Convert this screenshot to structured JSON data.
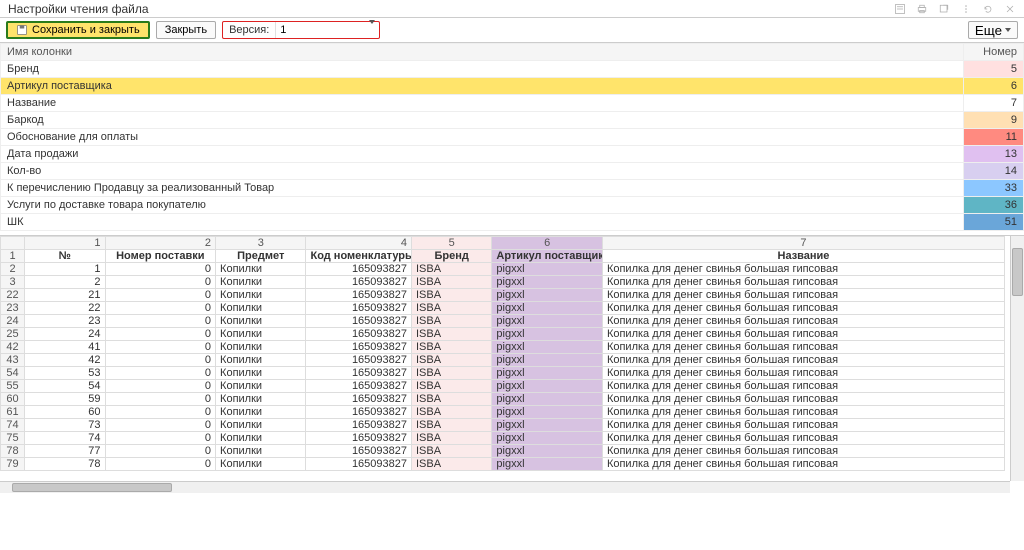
{
  "title": "Настройки чтения файла",
  "toolbar": {
    "save_close": "Сохранить и закрыть",
    "close": "Закрыть",
    "version_label": "Версия:",
    "version_value": "1",
    "more": "Еще"
  },
  "columns_table": {
    "col_name_header": "Имя колонки",
    "number_header": "Номер",
    "rows": [
      {
        "name": "Бренд",
        "num": 5,
        "color": "bg-pink"
      },
      {
        "name": "Артикул поставщика",
        "num": 6,
        "color": "bg-purple",
        "selected": true
      },
      {
        "name": "Название",
        "num": 7,
        "color": ""
      },
      {
        "name": "Баркод",
        "num": 9,
        "color": "bg-peach"
      },
      {
        "name": "Обоснование для оплаты",
        "num": 11,
        "color": "bg-salmon"
      },
      {
        "name": "Дата продажи",
        "num": 13,
        "color": "bg-violet"
      },
      {
        "name": "Кол-во",
        "num": 14,
        "color": "bg-lilac"
      },
      {
        "name": "К перечислению Продавцу за реализованный Товар",
        "num": 33,
        "color": "bg-sky"
      },
      {
        "name": "Услуги по доставке товара покупателю",
        "num": 36,
        "color": "bg-teal"
      },
      {
        "name": "ШК",
        "num": 51,
        "color": "bg-blue2"
      }
    ]
  },
  "sheet": {
    "col_numbers": [
      "",
      "1",
      "2",
      "3",
      "4",
      "5",
      "6",
      "7"
    ],
    "headers": {
      "c2": "№",
      "c3": "Номер поставки",
      "c4": "Предмет",
      "c5": "Код номенклатуры",
      "c6": "Бренд",
      "c7": "Артикул поставщика",
      "c8": "Название"
    },
    "rows": [
      {
        "rh": "2",
        "n": 1,
        "post": 0,
        "subj": "Копилки",
        "code": 165093827,
        "brand": "ISBA",
        "art": "pigxxl",
        "name": "Копилка для денег свинья большая гипсовая"
      },
      {
        "rh": "3",
        "n": 2,
        "post": 0,
        "subj": "Копилки",
        "code": 165093827,
        "brand": "ISBA",
        "art": "pigxxl",
        "name": "Копилка для денег свинья большая гипсовая"
      },
      {
        "rh": "22",
        "n": 21,
        "post": 0,
        "subj": "Копилки",
        "code": 165093827,
        "brand": "ISBA",
        "art": "pigxxl",
        "name": "Копилка для денег свинья большая гипсовая"
      },
      {
        "rh": "23",
        "n": 22,
        "post": 0,
        "subj": "Копилки",
        "code": 165093827,
        "brand": "ISBA",
        "art": "pigxxl",
        "name": "Копилка для денег свинья большая гипсовая"
      },
      {
        "rh": "24",
        "n": 23,
        "post": 0,
        "subj": "Копилки",
        "code": 165093827,
        "brand": "ISBA",
        "art": "pigxxl",
        "name": "Копилка для денег свинья большая гипсовая"
      },
      {
        "rh": "25",
        "n": 24,
        "post": 0,
        "subj": "Копилки",
        "code": 165093827,
        "brand": "ISBA",
        "art": "pigxxl",
        "name": "Копилка для денег свинья большая гипсовая"
      },
      {
        "rh": "42",
        "n": 41,
        "post": 0,
        "subj": "Копилки",
        "code": 165093827,
        "brand": "ISBA",
        "art": "pigxxl",
        "name": "Копилка для денег свинья большая гипсовая"
      },
      {
        "rh": "43",
        "n": 42,
        "post": 0,
        "subj": "Копилки",
        "code": 165093827,
        "brand": "ISBA",
        "art": "pigxxl",
        "name": "Копилка для денег свинья большая гипсовая"
      },
      {
        "rh": "54",
        "n": 53,
        "post": 0,
        "subj": "Копилки",
        "code": 165093827,
        "brand": "ISBA",
        "art": "pigxxl",
        "name": "Копилка для денег свинья большая гипсовая"
      },
      {
        "rh": "55",
        "n": 54,
        "post": 0,
        "subj": "Копилки",
        "code": 165093827,
        "brand": "ISBA",
        "art": "pigxxl",
        "name": "Копилка для денег свинья большая гипсовая"
      },
      {
        "rh": "60",
        "n": 59,
        "post": 0,
        "subj": "Копилки",
        "code": 165093827,
        "brand": "ISBA",
        "art": "pigxxl",
        "name": "Копилка для денег свинья большая гипсовая"
      },
      {
        "rh": "61",
        "n": 60,
        "post": 0,
        "subj": "Копилки",
        "code": 165093827,
        "brand": "ISBA",
        "art": "pigxxl",
        "name": "Копилка для денег свинья большая гипсовая"
      },
      {
        "rh": "74",
        "n": 73,
        "post": 0,
        "subj": "Копилки",
        "code": 165093827,
        "brand": "ISBA",
        "art": "pigxxl",
        "name": "Копилка для денег свинья большая гипсовая"
      },
      {
        "rh": "75",
        "n": 74,
        "post": 0,
        "subj": "Копилки",
        "code": 165093827,
        "brand": "ISBA",
        "art": "pigxxl",
        "name": "Копилка для денег свинья большая гипсовая"
      },
      {
        "rh": "78",
        "n": 77,
        "post": 0,
        "subj": "Копилки",
        "code": 165093827,
        "brand": "ISBA",
        "art": "pigxxl",
        "name": "Копилка для денег свинья большая гипсовая"
      },
      {
        "rh": "79",
        "n": 78,
        "post": 0,
        "subj": "Копилки",
        "code": 165093827,
        "brand": "ISBA",
        "art": "pigxxl",
        "name": "Копилка для денег свинья большая гипсовая"
      }
    ]
  }
}
